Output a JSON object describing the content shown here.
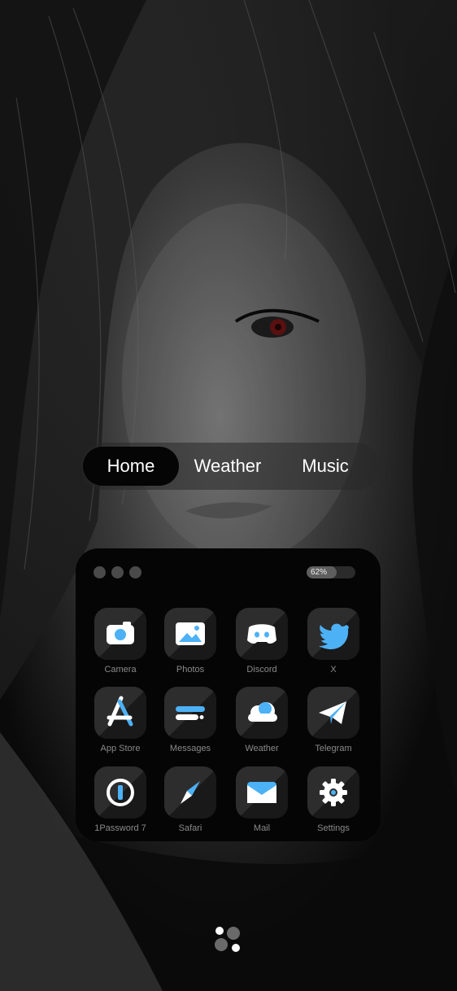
{
  "tabs": [
    {
      "label": "Home",
      "active": true
    },
    {
      "label": "Weather",
      "active": false
    },
    {
      "label": "Music",
      "active": false
    }
  ],
  "panel": {
    "battery": {
      "text": "62%",
      "level": 0.62
    },
    "apps": [
      {
        "label": "Camera",
        "icon": "camera-icon"
      },
      {
        "label": "Photos",
        "icon": "photos-icon"
      },
      {
        "label": "Discord",
        "icon": "discord-icon"
      },
      {
        "label": "X",
        "icon": "twitter-bird-icon"
      },
      {
        "label": "App Store",
        "icon": "app-store-icon"
      },
      {
        "label": "Messages",
        "icon": "messages-icon"
      },
      {
        "label": "Weather",
        "icon": "cloud-icon"
      },
      {
        "label": "Telegram",
        "icon": "paper-plane-icon"
      },
      {
        "label": "1Password 7",
        "icon": "1password-key-icon"
      },
      {
        "label": "Safari",
        "icon": "compass-icon"
      },
      {
        "label": "Mail",
        "icon": "envelope-icon"
      },
      {
        "label": "Settings",
        "icon": "gear-icon"
      }
    ]
  },
  "colors": {
    "accent_blue": "#4db1f5",
    "icon_white": "#ffffff",
    "tile_bg": "#2d2d2d",
    "panel_bg": "#050505",
    "label_gray": "#8a8a8a"
  }
}
